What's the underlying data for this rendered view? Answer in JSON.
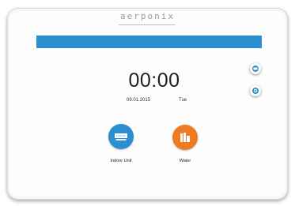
{
  "device": {
    "brand": "aerponix"
  },
  "status": {
    "time": "00:00",
    "date": "09.01.2015",
    "day": "Tue"
  },
  "apps": [
    {
      "label": "Indoor Unit",
      "icon": "indoor-unit-icon",
      "color": "#2a8fd0"
    },
    {
      "label": "Water",
      "icon": "water-tank-icon",
      "color": "#ee7a22"
    }
  ],
  "side_buttons": [
    {
      "icon": "mode-icon"
    },
    {
      "icon": "settings-icon"
    }
  ],
  "colors": {
    "accent_blue": "#2a8fd0",
    "accent_orange": "#ee7a22"
  }
}
